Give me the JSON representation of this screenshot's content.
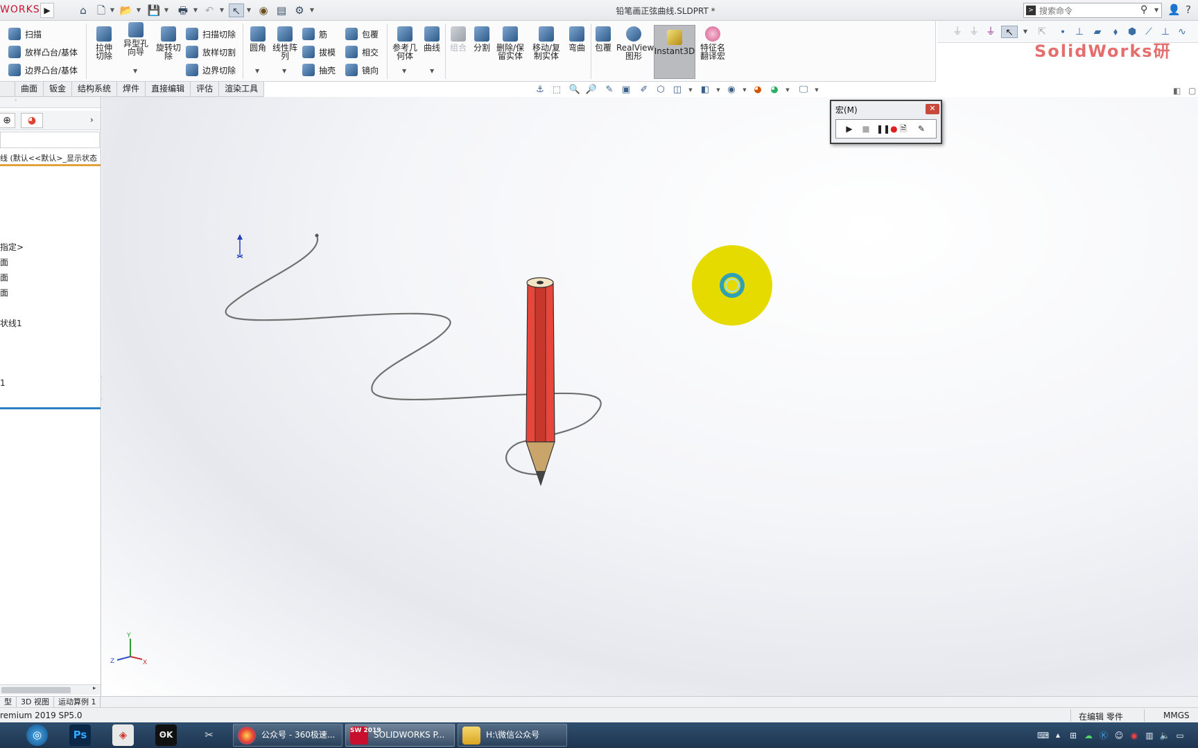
{
  "app": {
    "logo_text": "WORKS",
    "document_title": "铅笔画正弦曲线.SLDPRT *",
    "search": {
      "placeholder": "搜索命令"
    }
  },
  "command_manager": {
    "col1": [
      "扫描",
      "放样凸台/基体",
      "边界凸台/基体"
    ],
    "big_buttons": {
      "extrude_cut": "拉伸切除",
      "hole_wizard": "异型孔向导",
      "revolve_cut": "旋转切除"
    },
    "col2": [
      "扫描切除",
      "放样切割",
      "边界切除"
    ],
    "fillet": "圆角",
    "linear_pattern": "线性阵列",
    "col3": [
      "筋",
      "拔模",
      "抽壳"
    ],
    "col4": [
      "包覆",
      "相交",
      "镜向"
    ],
    "reference_geometry": "参考几何体",
    "curves": "曲线",
    "combine": "组合",
    "split": "分割",
    "delete_keep_body": "删除/保留实体",
    "move_copy_body": "移动/复制实体",
    "flex": "弯曲",
    "wrap": "包覆",
    "realview": "RealView图形",
    "instant3d": "Instant3D",
    "feature_translate_macro": "特征名翻译宏"
  },
  "watermark": "SolidWorks研",
  "tabs": [
    "曲面",
    "钣金",
    "结构系统",
    "焊件",
    "直接编辑",
    "评估",
    "渲染工具"
  ],
  "feature_tree": {
    "root": "线 (默认<<默认>_显示状态",
    "items": [
      "指定>",
      "面",
      "面",
      "面",
      "状线1",
      "1"
    ]
  },
  "macro_toolbar": {
    "title": "宏(M)",
    "close": "✕"
  },
  "bottom_tabs": [
    "型",
    "3D 视图",
    "运动算例 1"
  ],
  "status": {
    "version": "remium 2019 SP5.0",
    "mode": "在编辑 零件",
    "units": "MMGS"
  },
  "taskbar": {
    "buttons": [
      {
        "label": "公众号 - 360极速...",
        "badge_text": ""
      },
      {
        "label": "SOLIDWORKS P...",
        "badge_text": "SW 2019"
      },
      {
        "label": "H:\\微信公众号",
        "badge_text": ""
      }
    ]
  },
  "triad": {
    "x": "X",
    "y": "Y",
    "z": "Z"
  },
  "colors": {
    "pencil_body": "#e8463a",
    "pencil_tip_wood": "#c9a56b",
    "highlight_ring": "#e6db00",
    "curve": "#707070",
    "feature_accent": "#e1a23b",
    "rollback_bar": "#2e7ec4",
    "taskbar": "#1d3550"
  }
}
